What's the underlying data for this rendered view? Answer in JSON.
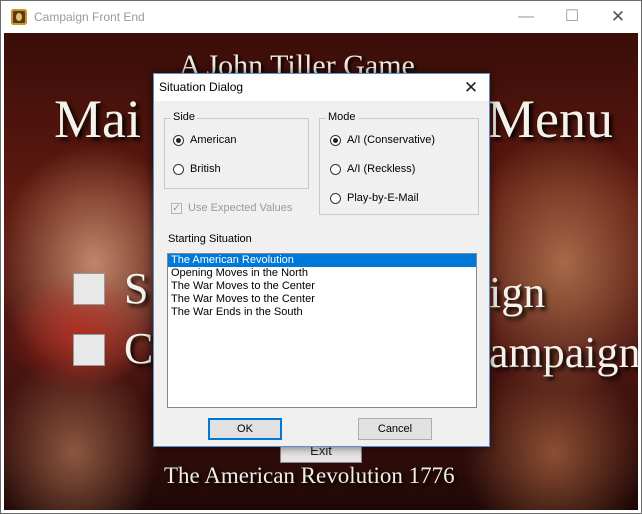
{
  "window": {
    "title": "Campaign Front End",
    "minimize": "—",
    "maximize": "☐",
    "close": "✕"
  },
  "background": {
    "line1": "A John Tiller Game",
    "line2_left": "Mai",
    "line2_right": "Menu",
    "item1_left": "S",
    "item1_right": "ign",
    "item2_left": "C",
    "item2_right": "ampaign",
    "exit_label": "Exit",
    "footer": "The American Revolution 1776"
  },
  "dialog": {
    "title": "Situation Dialog",
    "close": "✕",
    "side": {
      "label": "Side",
      "options": [
        "American",
        "British"
      ],
      "selected": "American"
    },
    "mode": {
      "label": "Mode",
      "options": [
        "A/I (Conservative)",
        "A/I (Reckless)",
        "Play-by-E-Mail"
      ],
      "selected": "A/I (Conservative)"
    },
    "use_expected_values": {
      "label": "Use Expected Values",
      "checked": true,
      "enabled": false
    },
    "starting_situation": {
      "label": "Starting Situation",
      "items": [
        "The American Revolution",
        "Opening Moves in the North",
        "The War Moves to the Center",
        "The War Moves to the Center",
        "The War Ends in the South"
      ],
      "selected_index": 0
    },
    "ok_label": "OK",
    "cancel_label": "Cancel"
  }
}
